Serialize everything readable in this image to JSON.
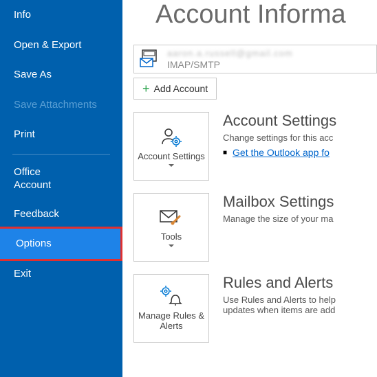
{
  "sidebar": {
    "info": "Info",
    "open_export": "Open & Export",
    "save_as": "Save As",
    "save_attachments": "Save Attachments",
    "print": "Print",
    "office_account": "Office\nAccount",
    "feedback": "Feedback",
    "options": "Options",
    "exit": "Exit"
  },
  "main": {
    "title": "Account Informa",
    "account_email": "aaron.a.russell@gmail.com",
    "account_type": "IMAP/SMTP",
    "add_account": "Add Account",
    "sections": [
      {
        "tile_label": "Account Settings",
        "title": "Account Settings",
        "desc": "Change settings for this acc",
        "link": "Get the Outlook app fo"
      },
      {
        "tile_label": "Tools",
        "title": "Mailbox Settings",
        "desc": "Manage the size of your ma"
      },
      {
        "tile_label": "Manage Rules & Alerts",
        "title": "Rules and Alerts",
        "desc": "Use Rules and Alerts to help",
        "desc2": "updates when items are add"
      }
    ]
  }
}
